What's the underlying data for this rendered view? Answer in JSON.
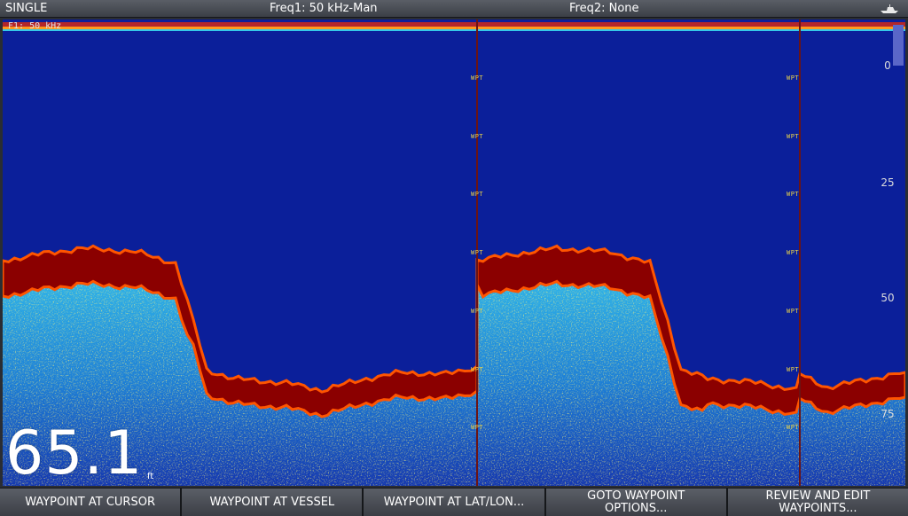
{
  "topbar": {
    "mode": "SINGLE",
    "freq1": "Freq1: 50 kHz-Man",
    "freq2": "Freq2: None",
    "icon": "boat-icon"
  },
  "sonar": {
    "channel_label": "F1: 50 kHz",
    "waypoint_marker": "WPT",
    "depth_scale": [
      "0",
      "25",
      "50",
      "75"
    ],
    "colors": {
      "water": "#0b1f9a",
      "bottom_hard": "#8b0000",
      "bottom_edge": "#ff5500",
      "return_weak": "#27a6e6",
      "return_mid": "#e7e24a",
      "marker_line": "#7a1a1a"
    }
  },
  "readout": {
    "depth": "65.1",
    "unit": "ft"
  },
  "softkeys": [
    "WAYPOINT AT CURSOR",
    "WAYPOINT AT VESSEL",
    "WAYPOINT AT LAT/LON...",
    "GOTO WAYPOINT\nOPTIONS...",
    "REVIEW AND EDIT\nWAYPOINTS..."
  ]
}
